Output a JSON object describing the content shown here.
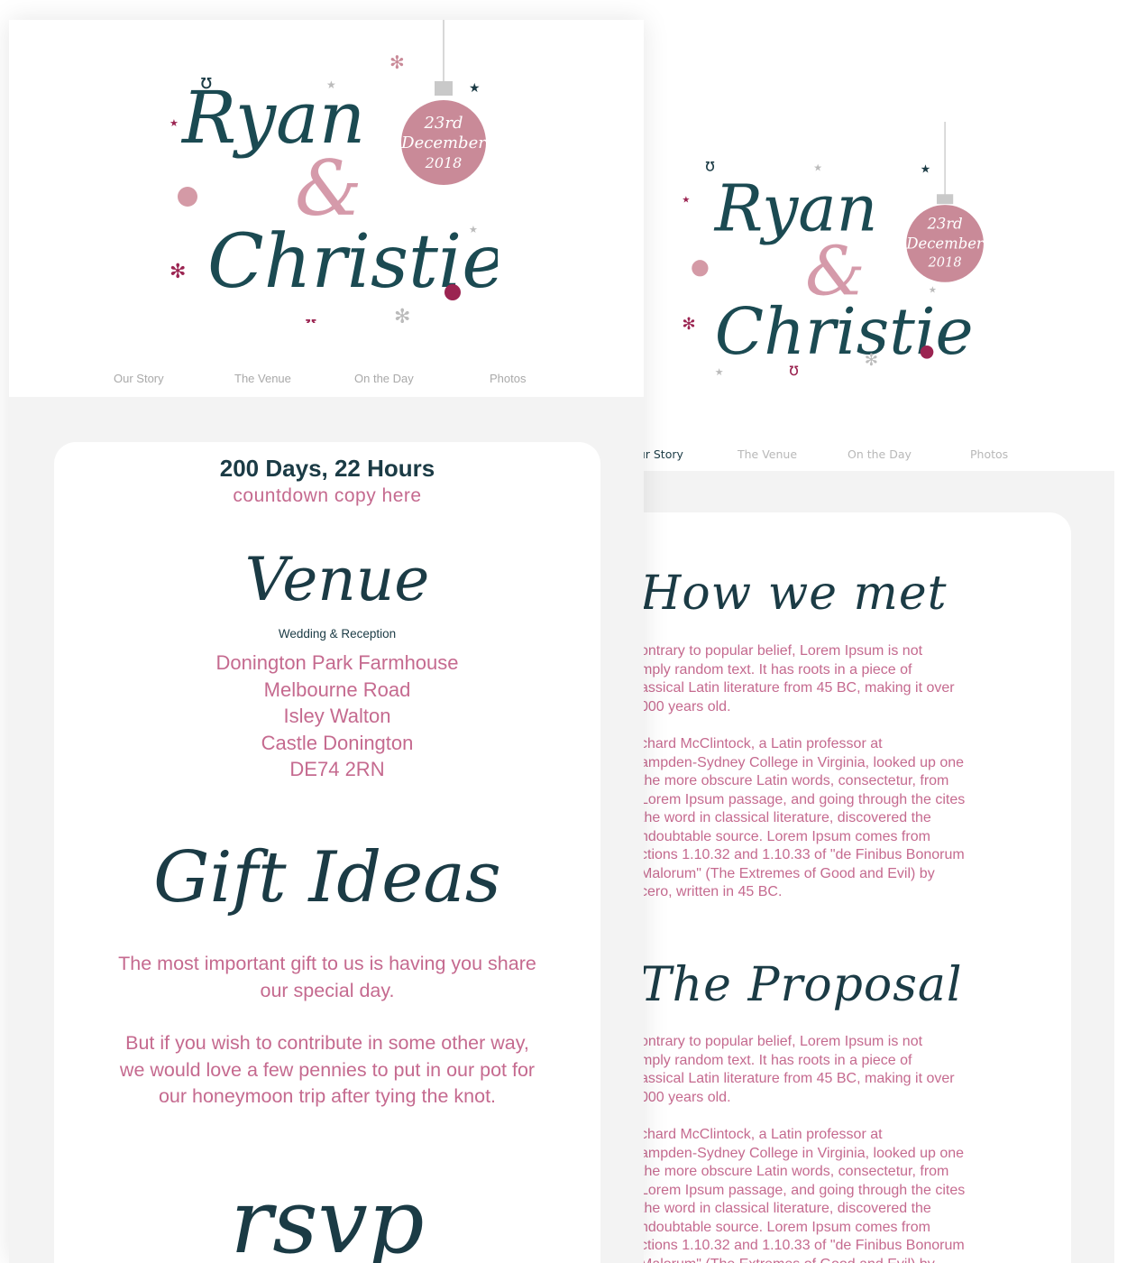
{
  "logo": {
    "name1": "Ryan",
    "amp": "&",
    "name2": "Christie",
    "date_line1": "23rd",
    "date_line2": "December",
    "date_line3": "2018"
  },
  "nav": {
    "items": [
      "Our Story",
      "The Venue",
      "On the Day",
      "Photos"
    ],
    "back_items": [
      "Our Story",
      "The Venue",
      "On the Day",
      "Photos"
    ]
  },
  "front": {
    "countdown": "200 Days, 22 Hours",
    "countdown_sub": "countdown copy here",
    "venue_title": "Venue",
    "venue_sub": "Wedding & Reception",
    "address": [
      "Donington Park Farmhouse",
      "Melbourne Road",
      "Isley Walton",
      "Castle Donington",
      "DE74 2RN"
    ],
    "gift_title": "Gift Ideas",
    "gift_p1": "The most important gift to us is having you share our special day.",
    "gift_p2": "But if you wish to contribute in some other way, we would love a few pennies to put in our pot for our honeymoon trip after tying the knot.",
    "rsvp_title": "rsvp"
  },
  "back": {
    "how_title": "How we met",
    "how_p1": "ontrary to popular belief, Lorem Ipsum is not\nmply random text. It has roots in a piece of\nassical Latin literature from 45 BC, making it over\n000 years old.",
    "how_p2": "chard McClintock, a Latin professor at\nampden-Sydney College in Virginia, looked up one\nthe more obscure Latin words, consectetur, from\nLorem Ipsum passage, and going through the cites\nthe word in classical literature, discovered the\nndoubtable source. Lorem Ipsum comes from\nctions 1.10.32 and 1.10.33 of \"de Finibus Bonorum\nMalorum\" (The Extremes of Good and Evil) by\ncero, written in 45 BC.",
    "proposal_title": "The Proposal",
    "proposal_p1": "ontrary to popular belief, Lorem Ipsum is not\nmply random text. It has roots in a piece of\nassical Latin literature from 45 BC, making it over\n000 years old.",
    "proposal_p2": "chard McClintock, a Latin professor at\nampden-Sydney College in Virginia, looked up one\nthe more obscure Latin words, consectetur, from\nLorem Ipsum passage, and going through the cites\nthe word in classical literature, discovered the\nndoubtable source. Lorem Ipsum comes from\nctions 1.10.32 and 1.10.33 of \"de Finibus Bonorum\nMalorum\" (The Extremes of Good and Evil) by"
  },
  "colors": {
    "teal": "#1b3b45",
    "pink": "#c56a8f",
    "bauble": "#c98a98",
    "crimson": "#9b2451",
    "grey": "#a9a9a9"
  }
}
